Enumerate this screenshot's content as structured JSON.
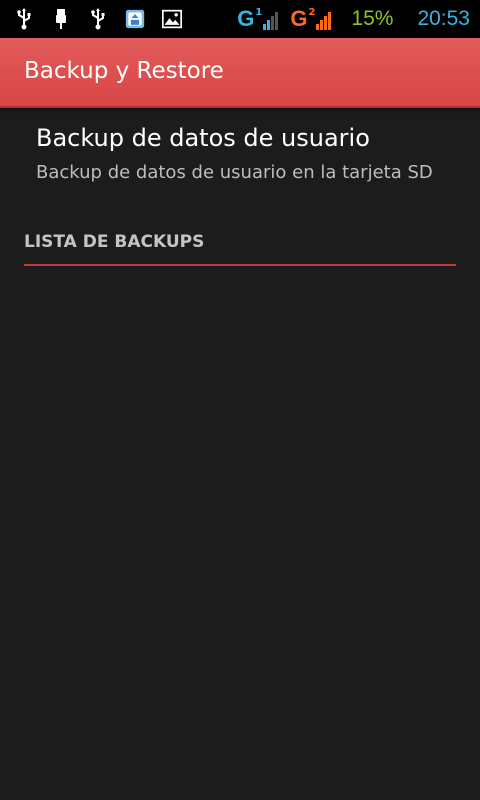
{
  "status_bar": {
    "icons": [
      "usb-icon",
      "usb-connected-icon",
      "usb-icon",
      "backup-app-icon",
      "gallery-icon"
    ],
    "sim1": {
      "letter": "G",
      "slot": "1",
      "color": "#33b5e5"
    },
    "sim2": {
      "letter": "G",
      "slot": "2",
      "color": "#ff6a1a"
    },
    "battery": "15%",
    "battery_color": "#8fc31f",
    "time": "20:53",
    "time_color": "#33b5e5"
  },
  "action_bar": {
    "title": "Backup y Restore",
    "color": "#dc4f4f"
  },
  "preference": {
    "title": "Backup de datos de usuario",
    "summary": "Backup de datos de usuario en la tarjeta SD"
  },
  "category": {
    "label": "LISTA DE BACKUPS",
    "divider_color": "#c0393b"
  }
}
